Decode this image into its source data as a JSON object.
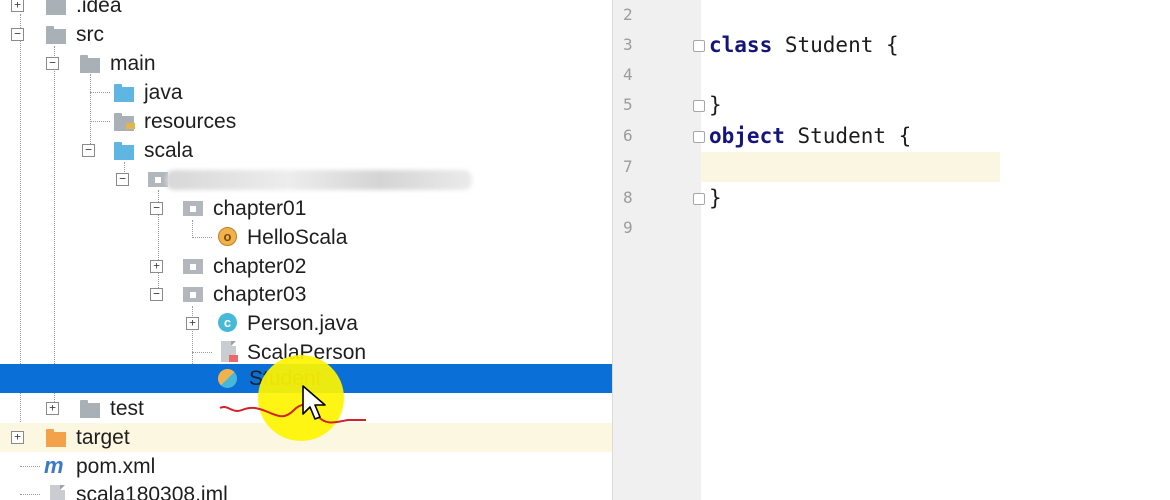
{
  "project_tree": {
    "items": [
      {
        "label": ".idea",
        "icon": "folder-icon",
        "expanded": false
      },
      {
        "label": "src",
        "icon": "folder-icon",
        "expanded": true
      },
      {
        "label": "main",
        "icon": "folder-icon",
        "expanded": true
      },
      {
        "label": "java",
        "icon": "folder-blue-icon"
      },
      {
        "label": "resources",
        "icon": "resources-folder-icon"
      },
      {
        "label": "scala",
        "icon": "folder-blue-icon",
        "expanded": true
      },
      {
        "label": "",
        "icon": "package-icon",
        "expanded": true,
        "label_obscured": true
      },
      {
        "label": "chapter01",
        "icon": "package-icon",
        "expanded": true
      },
      {
        "label": "HelloScala",
        "icon": "scala-object-icon",
        "icon_glyph": "o"
      },
      {
        "label": "chapter02",
        "icon": "package-icon",
        "expanded": false
      },
      {
        "label": "chapter03",
        "icon": "package-icon",
        "expanded": true
      },
      {
        "label": "Person.java",
        "icon": "java-class-icon",
        "icon_glyph": "c",
        "expanded": false
      },
      {
        "label": "ScalaPerson",
        "icon": "scala-file-icon"
      },
      {
        "label": "Student",
        "icon": "scala-class-object-icon",
        "selected": true
      },
      {
        "label": "test",
        "icon": "folder-icon",
        "expanded": false
      },
      {
        "label": "target",
        "icon": "folder-orange-icon",
        "expanded": false
      },
      {
        "label": "pom.xml",
        "icon": "maven-icon",
        "icon_glyph": "m"
      },
      {
        "label": "scala180308.iml",
        "icon": "iml-file-icon"
      }
    ],
    "expand_glyph": "+",
    "collapse_glyph": "−"
  },
  "editor": {
    "line_numbers": [
      "2",
      "3",
      "4",
      "5",
      "6",
      "7",
      "8",
      "9"
    ],
    "lines": [
      {
        "keyword": "",
        "rest": ""
      },
      {
        "keyword": "class",
        "rest": " Student {"
      },
      {
        "keyword": "",
        "rest": ""
      },
      {
        "keyword": "",
        "rest": "}"
      },
      {
        "keyword": "object",
        "rest": " Student {"
      },
      {
        "keyword": "",
        "rest": ""
      },
      {
        "keyword": "",
        "rest": "}"
      },
      {
        "keyword": "",
        "rest": ""
      }
    ],
    "current_line": "7"
  },
  "colors": {
    "selection": "#0a6fd6",
    "keyword": "#14147a",
    "cursor_highlight": "#fff400",
    "current_line": "#fbf6e1"
  }
}
